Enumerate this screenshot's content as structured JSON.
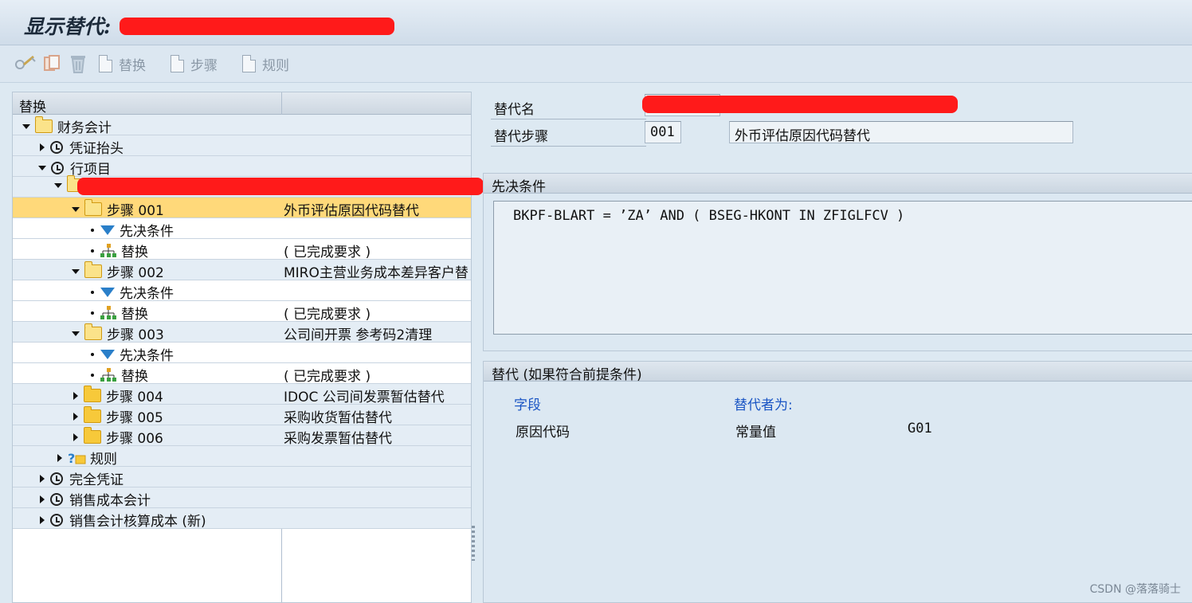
{
  "window": {
    "title": "显示替代:"
  },
  "toolbar": {
    "substitution_label": "替换",
    "step_label": "步骤",
    "rule_label": "规则"
  },
  "tree": {
    "header": "替换",
    "rows": [
      {
        "label": "财务会计",
        "desc": ""
      },
      {
        "label": "凭证抬头",
        "desc": ""
      },
      {
        "label": "行项目",
        "desc": ""
      },
      {
        "label": "",
        "desc": ""
      },
      {
        "label": "步骤 001",
        "desc": "外币评估原因代码替代"
      },
      {
        "label": "先决条件",
        "desc": ""
      },
      {
        "label": "替换",
        "desc": "( 已完成要求 )"
      },
      {
        "label": "步骤 002",
        "desc": "MIRO主营业务成本差异客户替"
      },
      {
        "label": "先决条件",
        "desc": ""
      },
      {
        "label": "替换",
        "desc": "( 已完成要求 )"
      },
      {
        "label": "步骤 003",
        "desc": "公司间开票 参考码2清理"
      },
      {
        "label": "先决条件",
        "desc": ""
      },
      {
        "label": "替换",
        "desc": "( 已完成要求 )"
      },
      {
        "label": "步骤 004",
        "desc": "IDOC 公司间发票暂估替代"
      },
      {
        "label": "步骤 005",
        "desc": "采购收货暂估替代"
      },
      {
        "label": "步骤 006",
        "desc": "采购发票暂估替代"
      },
      {
        "label": "规则",
        "desc": ""
      },
      {
        "label": "完全凭证",
        "desc": ""
      },
      {
        "label": "销售成本会计",
        "desc": ""
      },
      {
        "label": "销售会计核算成本 (新)",
        "desc": ""
      }
    ]
  },
  "details": {
    "name_label": "替代名",
    "step_label": "替代步骤",
    "step_value": "001",
    "step_desc": "外币评估原因代码替代"
  },
  "prerequisite": {
    "title": "先决条件",
    "expression": "BKPF-BLART = ’ZA’ AND ( BSEG-HKONT IN ZFIGLFCV )"
  },
  "substitution": {
    "title": "替代 (如果符合前提条件)",
    "col_field": "字段",
    "col_replaced_by": "替代者为:",
    "field": "原因代码",
    "type": "常量值",
    "value": "G01"
  },
  "watermark": "CSDN @落落骑士",
  "colors": {
    "selected_row": "#ffd97a",
    "redaction": "#ff1a1a",
    "link_blue": "#1a55c4"
  }
}
